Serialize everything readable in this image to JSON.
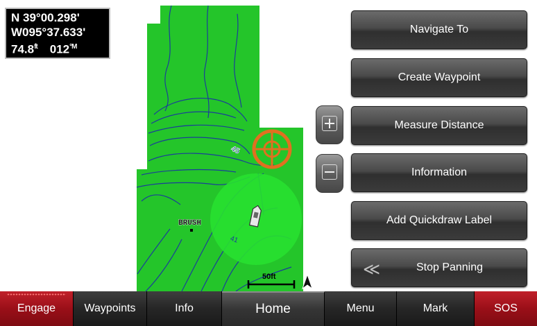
{
  "coords": {
    "lat": "N  39°00.298'",
    "lon": "W095°37.633'",
    "depth": "74.8",
    "depth_unit": "ft",
    "heading": "012",
    "heading_unit": "°M"
  },
  "map": {
    "brush_label": "BRUSH",
    "depth_labels": [
      "45",
      "41"
    ],
    "scale_label": "50ft",
    "colors": {
      "water": "#24c52a",
      "contour": "#1a3d9a",
      "cursor": "#e07020",
      "range": "#28e030"
    }
  },
  "menu": {
    "navigate_to": "Navigate To",
    "create_waypoint": "Create Waypoint",
    "measure_distance": "Measure Distance",
    "information": "Information",
    "add_quickdraw_label": "Add Quickdraw Label",
    "stop_panning": "Stop Panning"
  },
  "icons": {
    "zoom_in": "plus-icon",
    "zoom_out": "minus-icon",
    "stop_panning": "double-chevron-left-icon",
    "north": "north-arrow-icon",
    "cursor": "crosshair-cursor-icon",
    "boat": "boat-icon"
  },
  "tabs": {
    "engage": "Engage",
    "waypoints": "Waypoints",
    "info": "Info",
    "home": "Home",
    "menu": "Menu",
    "mark": "Mark",
    "sos": "SOS"
  }
}
